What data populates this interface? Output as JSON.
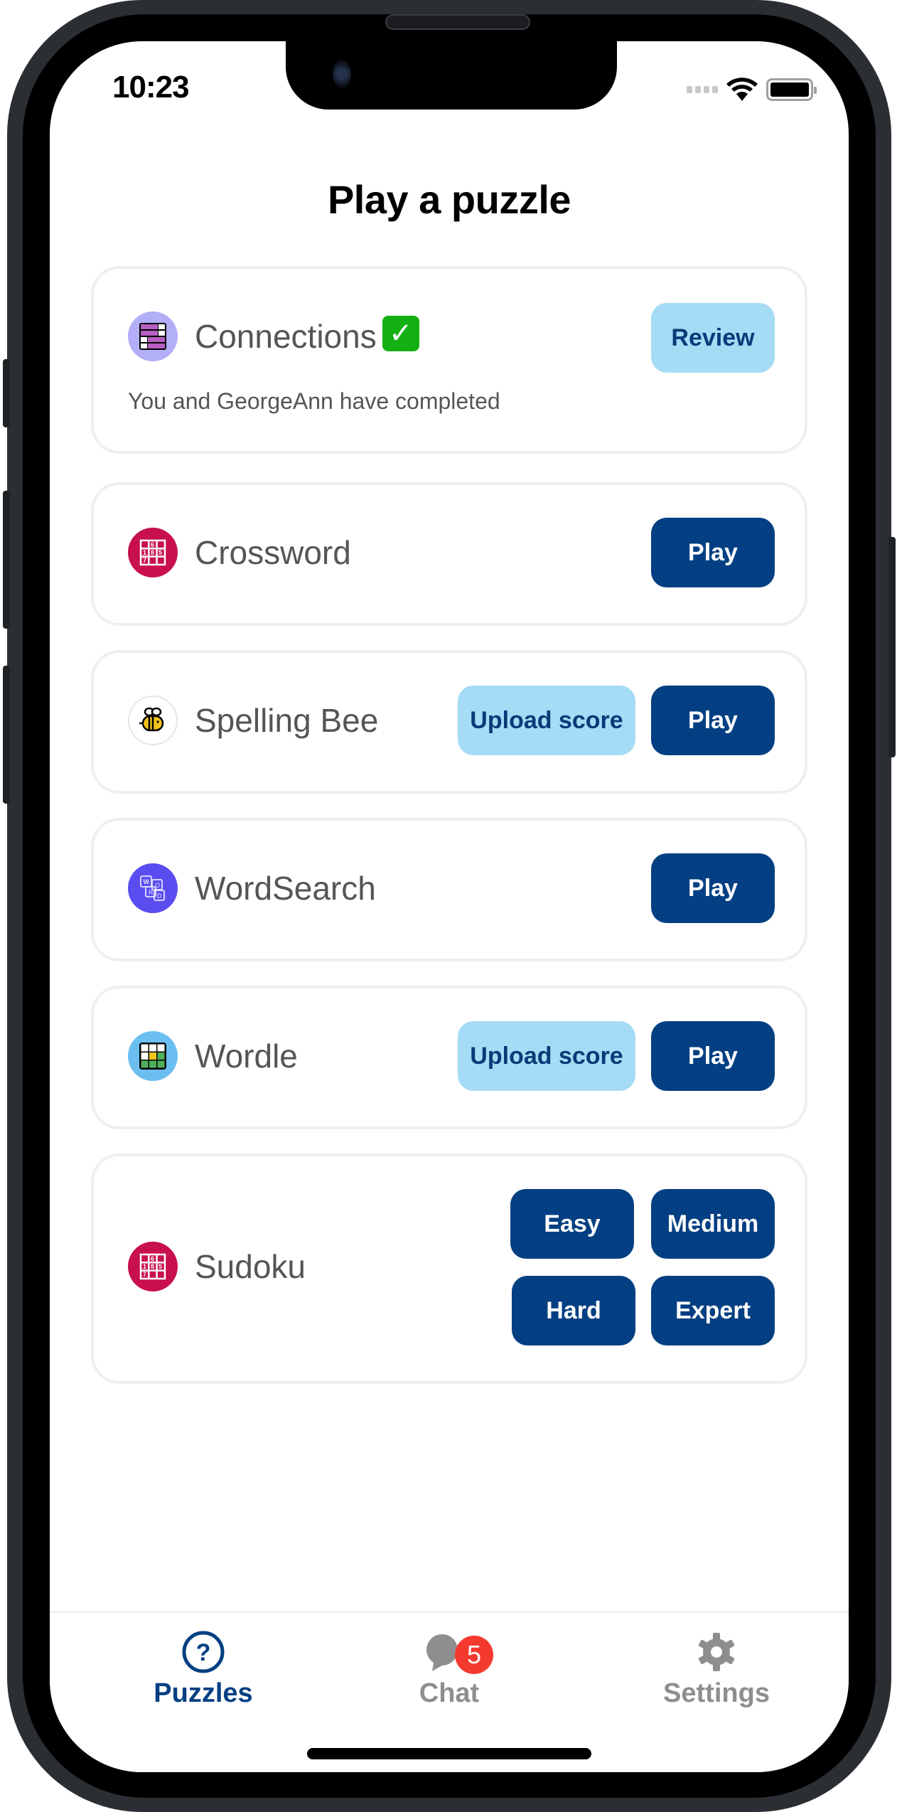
{
  "status_bar": {
    "time": "10:23"
  },
  "page": {
    "title": "Play a puzzle"
  },
  "puzzles": [
    {
      "name": "Connections",
      "icon": "connections-grid-icon",
      "icon_bg": "#b3aef8",
      "completed_mark": "✓",
      "subtext": "You and GeorgeAnn have completed",
      "buttons": [
        {
          "label": "Review",
          "style": "light"
        }
      ]
    },
    {
      "name": "Crossword",
      "icon": "crossword-grid-icon",
      "icon_bg": "#c8104c",
      "buttons": [
        {
          "label": "Play",
          "style": "dark"
        }
      ]
    },
    {
      "name": "Spelling Bee",
      "icon": "bee-icon",
      "icon_bg": "#ffffff",
      "buttons": [
        {
          "label": "Upload score",
          "style": "light"
        },
        {
          "label": "Play",
          "style": "dark"
        }
      ]
    },
    {
      "name": "WordSearch",
      "icon": "word-tiles-icon",
      "icon_bg": "#5a4df0",
      "buttons": [
        {
          "label": "Play",
          "style": "dark"
        }
      ]
    },
    {
      "name": "Wordle",
      "icon": "wordle-grid-icon",
      "icon_bg": "#6bbef0",
      "buttons": [
        {
          "label": "Upload score",
          "style": "light"
        },
        {
          "label": "Play",
          "style": "dark"
        }
      ]
    },
    {
      "name": "Sudoku",
      "icon": "sudoku-grid-icon",
      "icon_bg": "#c8104c",
      "buttons": [
        {
          "label": "Easy",
          "style": "dark"
        },
        {
          "label": "Medium",
          "style": "dark"
        },
        {
          "label": "Hard",
          "style": "dark"
        },
        {
          "label": "Expert",
          "style": "dark"
        }
      ]
    }
  ],
  "tabbar": {
    "tabs": [
      {
        "label": "Puzzles",
        "icon": "question-circle-icon",
        "active": true
      },
      {
        "label": "Chat",
        "icon": "chat-bubbles-icon",
        "active": false,
        "badge": "5"
      },
      {
        "label": "Settings",
        "icon": "gear-icon",
        "active": false
      }
    ]
  },
  "colors": {
    "primary": "#033f82",
    "primary_light": "#a6dbf5",
    "badge": "#f43a2f",
    "inactive": "#8e8e8e"
  }
}
